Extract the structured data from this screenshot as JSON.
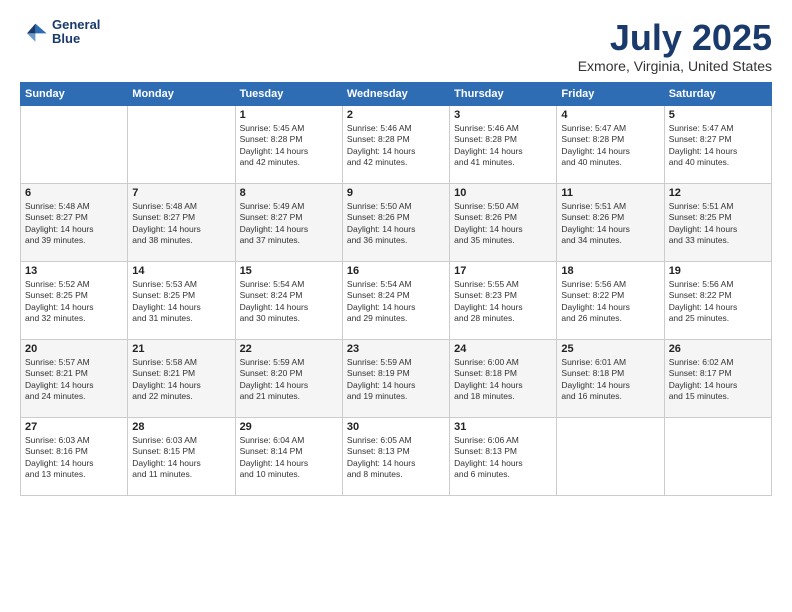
{
  "header": {
    "logo_line1": "General",
    "logo_line2": "Blue",
    "title": "July 2025",
    "location": "Exmore, Virginia, United States"
  },
  "weekdays": [
    "Sunday",
    "Monday",
    "Tuesday",
    "Wednesday",
    "Thursday",
    "Friday",
    "Saturday"
  ],
  "weeks": [
    [
      {
        "day": "",
        "info": ""
      },
      {
        "day": "",
        "info": ""
      },
      {
        "day": "1",
        "info": "Sunrise: 5:45 AM\nSunset: 8:28 PM\nDaylight: 14 hours\nand 42 minutes."
      },
      {
        "day": "2",
        "info": "Sunrise: 5:46 AM\nSunset: 8:28 PM\nDaylight: 14 hours\nand 42 minutes."
      },
      {
        "day": "3",
        "info": "Sunrise: 5:46 AM\nSunset: 8:28 PM\nDaylight: 14 hours\nand 41 minutes."
      },
      {
        "day": "4",
        "info": "Sunrise: 5:47 AM\nSunset: 8:28 PM\nDaylight: 14 hours\nand 40 minutes."
      },
      {
        "day": "5",
        "info": "Sunrise: 5:47 AM\nSunset: 8:27 PM\nDaylight: 14 hours\nand 40 minutes."
      }
    ],
    [
      {
        "day": "6",
        "info": "Sunrise: 5:48 AM\nSunset: 8:27 PM\nDaylight: 14 hours\nand 39 minutes."
      },
      {
        "day": "7",
        "info": "Sunrise: 5:48 AM\nSunset: 8:27 PM\nDaylight: 14 hours\nand 38 minutes."
      },
      {
        "day": "8",
        "info": "Sunrise: 5:49 AM\nSunset: 8:27 PM\nDaylight: 14 hours\nand 37 minutes."
      },
      {
        "day": "9",
        "info": "Sunrise: 5:50 AM\nSunset: 8:26 PM\nDaylight: 14 hours\nand 36 minutes."
      },
      {
        "day": "10",
        "info": "Sunrise: 5:50 AM\nSunset: 8:26 PM\nDaylight: 14 hours\nand 35 minutes."
      },
      {
        "day": "11",
        "info": "Sunrise: 5:51 AM\nSunset: 8:26 PM\nDaylight: 14 hours\nand 34 minutes."
      },
      {
        "day": "12",
        "info": "Sunrise: 5:51 AM\nSunset: 8:25 PM\nDaylight: 14 hours\nand 33 minutes."
      }
    ],
    [
      {
        "day": "13",
        "info": "Sunrise: 5:52 AM\nSunset: 8:25 PM\nDaylight: 14 hours\nand 32 minutes."
      },
      {
        "day": "14",
        "info": "Sunrise: 5:53 AM\nSunset: 8:25 PM\nDaylight: 14 hours\nand 31 minutes."
      },
      {
        "day": "15",
        "info": "Sunrise: 5:54 AM\nSunset: 8:24 PM\nDaylight: 14 hours\nand 30 minutes."
      },
      {
        "day": "16",
        "info": "Sunrise: 5:54 AM\nSunset: 8:24 PM\nDaylight: 14 hours\nand 29 minutes."
      },
      {
        "day": "17",
        "info": "Sunrise: 5:55 AM\nSunset: 8:23 PM\nDaylight: 14 hours\nand 28 minutes."
      },
      {
        "day": "18",
        "info": "Sunrise: 5:56 AM\nSunset: 8:22 PM\nDaylight: 14 hours\nand 26 minutes."
      },
      {
        "day": "19",
        "info": "Sunrise: 5:56 AM\nSunset: 8:22 PM\nDaylight: 14 hours\nand 25 minutes."
      }
    ],
    [
      {
        "day": "20",
        "info": "Sunrise: 5:57 AM\nSunset: 8:21 PM\nDaylight: 14 hours\nand 24 minutes."
      },
      {
        "day": "21",
        "info": "Sunrise: 5:58 AM\nSunset: 8:21 PM\nDaylight: 14 hours\nand 22 minutes."
      },
      {
        "day": "22",
        "info": "Sunrise: 5:59 AM\nSunset: 8:20 PM\nDaylight: 14 hours\nand 21 minutes."
      },
      {
        "day": "23",
        "info": "Sunrise: 5:59 AM\nSunset: 8:19 PM\nDaylight: 14 hours\nand 19 minutes."
      },
      {
        "day": "24",
        "info": "Sunrise: 6:00 AM\nSunset: 8:18 PM\nDaylight: 14 hours\nand 18 minutes."
      },
      {
        "day": "25",
        "info": "Sunrise: 6:01 AM\nSunset: 8:18 PM\nDaylight: 14 hours\nand 16 minutes."
      },
      {
        "day": "26",
        "info": "Sunrise: 6:02 AM\nSunset: 8:17 PM\nDaylight: 14 hours\nand 15 minutes."
      }
    ],
    [
      {
        "day": "27",
        "info": "Sunrise: 6:03 AM\nSunset: 8:16 PM\nDaylight: 14 hours\nand 13 minutes."
      },
      {
        "day": "28",
        "info": "Sunrise: 6:03 AM\nSunset: 8:15 PM\nDaylight: 14 hours\nand 11 minutes."
      },
      {
        "day": "29",
        "info": "Sunrise: 6:04 AM\nSunset: 8:14 PM\nDaylight: 14 hours\nand 10 minutes."
      },
      {
        "day": "30",
        "info": "Sunrise: 6:05 AM\nSunset: 8:13 PM\nDaylight: 14 hours\nand 8 minutes."
      },
      {
        "day": "31",
        "info": "Sunrise: 6:06 AM\nSunset: 8:13 PM\nDaylight: 14 hours\nand 6 minutes."
      },
      {
        "day": "",
        "info": ""
      },
      {
        "day": "",
        "info": ""
      }
    ]
  ]
}
